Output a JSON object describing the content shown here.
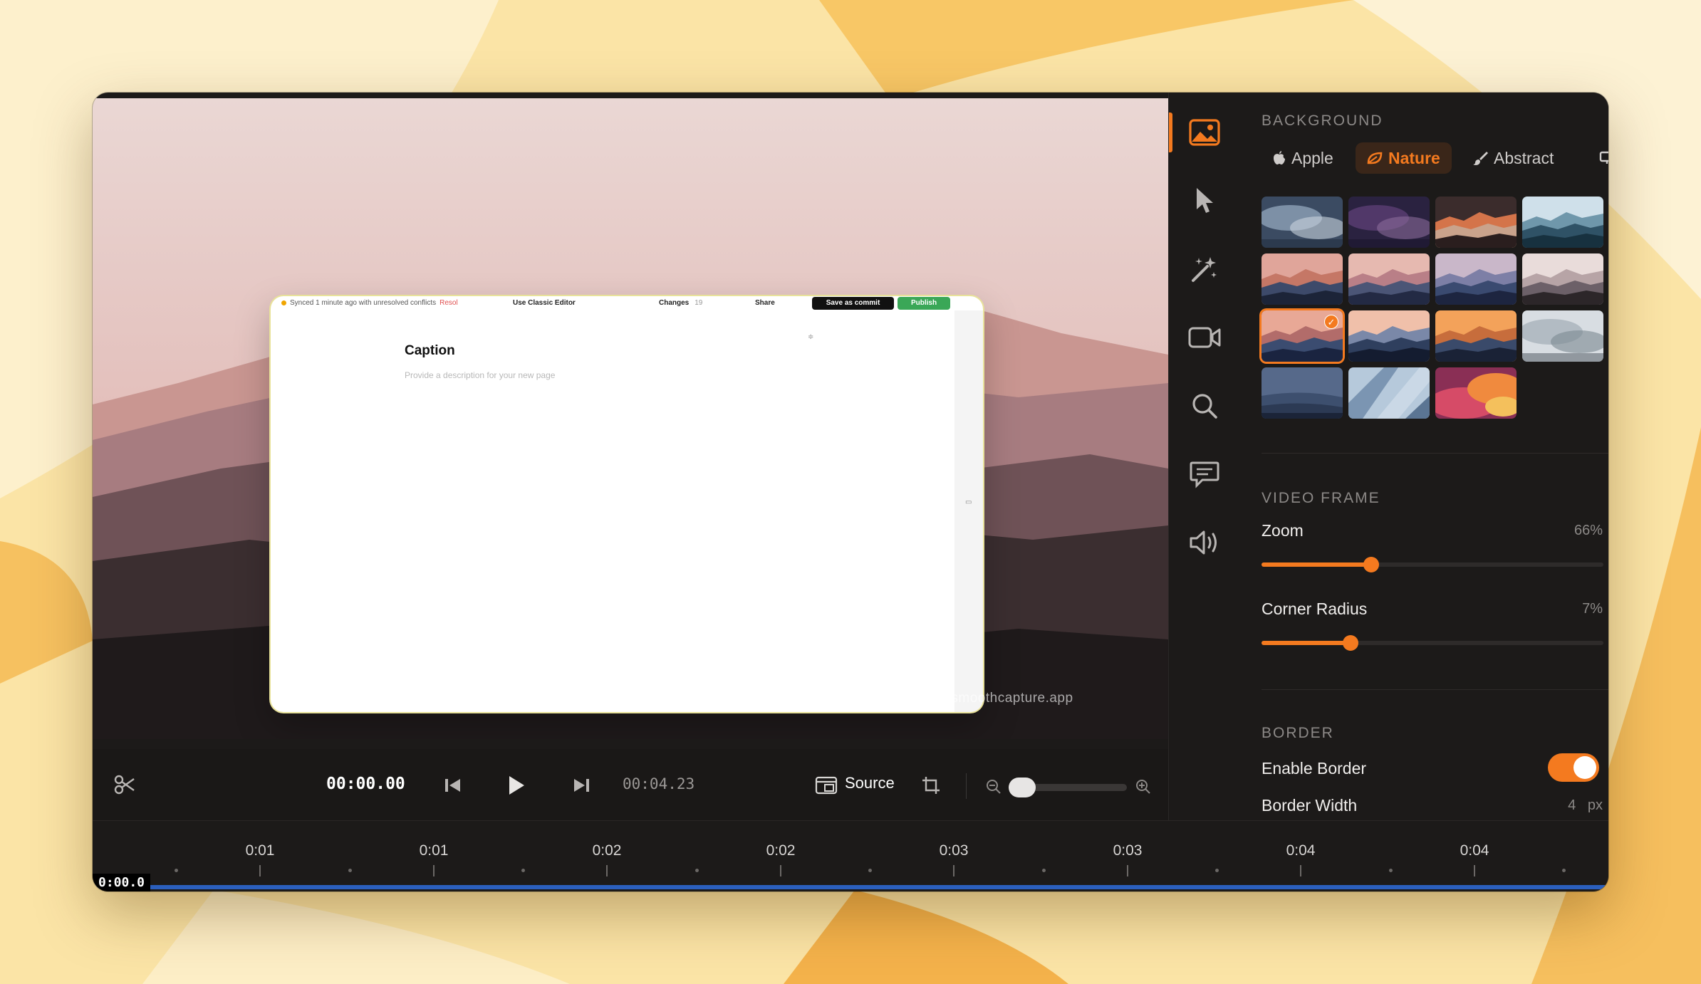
{
  "preview": {
    "watermark": "smoothcapture.app",
    "capture": {
      "sync_text": "Synced 1 minute ago with unresolved conflicts",
      "resolve_text": "Resol",
      "classic_editor": "Use Classic Editor",
      "changes_label": "Changes",
      "changes_count": "19",
      "share_label": "Share",
      "save_commit": "Save as commit",
      "publish": "Publish",
      "page_title": "Caption",
      "page_description": "Provide a description for your new page"
    }
  },
  "playback": {
    "current_time": "00:00.00",
    "total_time": "00:04.23",
    "source_label": "Source"
  },
  "timeline": {
    "labels": [
      "0:01",
      "0:01",
      "0:02",
      "0:02",
      "0:03",
      "0:03",
      "0:04",
      "0:04"
    ],
    "playhead": "0:00.0"
  },
  "rail": {
    "items": [
      "image-icon",
      "cursor-icon",
      "magic-wand-icon",
      "video-camera-icon",
      "zoom-icon",
      "caption-icon",
      "audio-icon"
    ],
    "active": "image-icon"
  },
  "panel": {
    "background": {
      "heading": "BACKGROUND",
      "tabs": [
        {
          "label": "Apple",
          "icon": "apple-icon"
        },
        {
          "label": "Nature",
          "icon": "leaf-icon",
          "active": true
        },
        {
          "label": "Abstract",
          "icon": "brush-icon"
        }
      ],
      "selected_thumbnail": 8
    },
    "video_frame": {
      "heading": "VIDEO FRAME",
      "zoom_label": "Zoom",
      "zoom_value": "66%",
      "zoom_fraction": 0.66,
      "corner_label": "Corner Radius",
      "corner_value": "7%",
      "corner_fraction": 0.28
    },
    "border": {
      "heading": "BORDER",
      "enable_label": "Enable Border",
      "enabled": true,
      "width_label": "Border Width",
      "width_value": "4",
      "width_unit": "px"
    }
  },
  "colors": {
    "accent": "#f47a1f",
    "timeline_progress": "#2b5fbd",
    "panel_bg": "#1c1a19"
  }
}
